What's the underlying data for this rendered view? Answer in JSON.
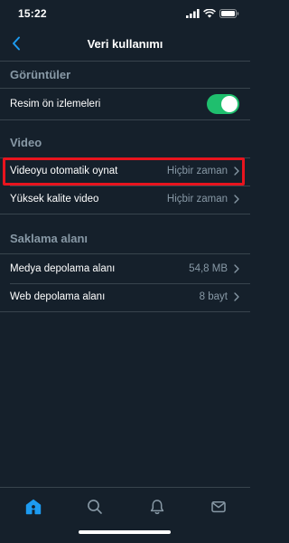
{
  "status_bar": {
    "time": "15:22"
  },
  "nav": {
    "title": "Veri kullanımı"
  },
  "sections": {
    "images": {
      "title": "Görüntüler"
    },
    "video": {
      "title": "Video"
    },
    "storage": {
      "title": "Saklama alanı"
    }
  },
  "rows": {
    "image_preview": {
      "label": "Resim ön izlemeleri",
      "toggle_on": true
    },
    "video_autoplay": {
      "label": "Videoyu otomatik oynat",
      "value": "Hiçbir zaman"
    },
    "hq_video": {
      "label": "Yüksek kalite video",
      "value": "Hiçbir zaman"
    },
    "media_storage": {
      "label": "Medya depolama alanı",
      "value": "54,8 MB"
    },
    "web_storage": {
      "label": "Web depolama alanı",
      "value": "8 bayt"
    }
  },
  "tabs": [
    "home-icon",
    "search-icon",
    "notifications-icon",
    "messages-icon"
  ],
  "colors": {
    "background": "#15202b",
    "accent": "#1d9bf0",
    "toggle_on": "#1fbf6e",
    "secondary_text": "#8899a6",
    "highlight": "#e8141e",
    "divider": "#38444d"
  }
}
